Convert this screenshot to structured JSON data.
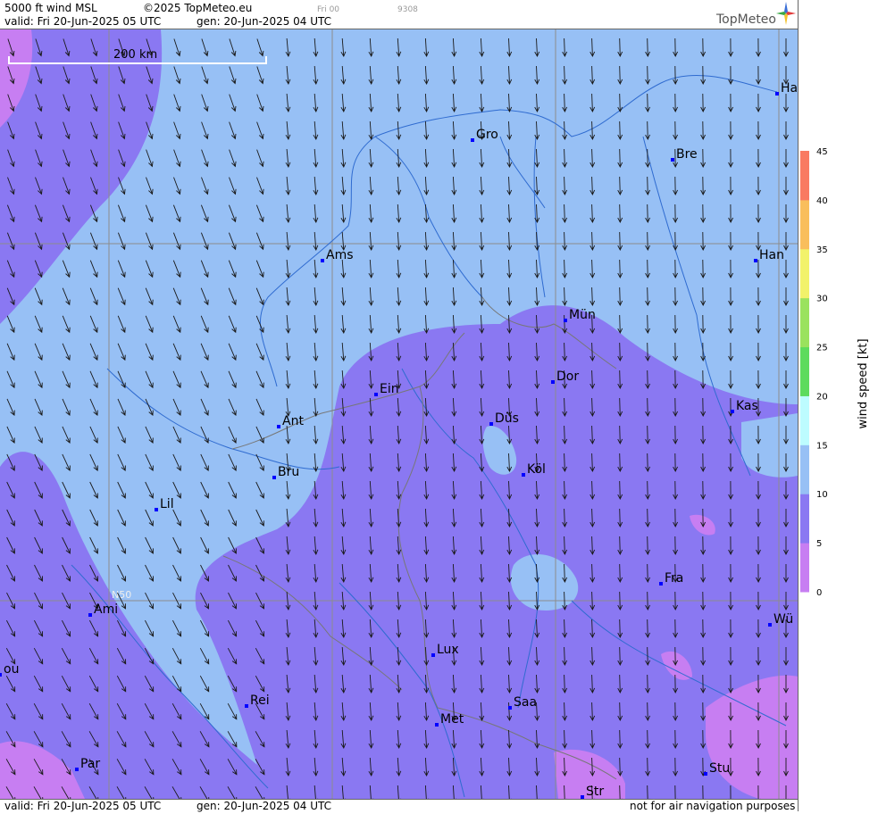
{
  "header": {
    "product": "5000 ft wind MSL",
    "copyright": "©2025 TopMeteo.eu",
    "valid": "valid:  Fri  20-Jun-2025  05 UTC",
    "gen": "gen: 20-Jun-2025 04 UTC",
    "faint_day": "Fri 00",
    "faint_code": "9308",
    "brand": "TopMeteo"
  },
  "footer": {
    "valid": "valid:  Fri  20-Jun-2025  05 UTC",
    "gen": "gen: 20-Jun-2025 04 UTC",
    "disclaimer": "not for air navigation purposes"
  },
  "map": {
    "scale_label": "200 km",
    "grid_label": "N50",
    "cities": [
      {
        "name": "Gro"
      },
      {
        "name": "Bre"
      },
      {
        "name": "Ha"
      },
      {
        "name": "Han"
      },
      {
        "name": "Ams"
      },
      {
        "name": "Mün"
      },
      {
        "name": "Dor"
      },
      {
        "name": "Ein"
      },
      {
        "name": "Düs"
      },
      {
        "name": "Kas"
      },
      {
        "name": "Ant"
      },
      {
        "name": "Bru"
      },
      {
        "name": "Köl"
      },
      {
        "name": "Lil"
      },
      {
        "name": "Fra"
      },
      {
        "name": "Ami"
      },
      {
        "name": "Wü"
      },
      {
        "name": "Lux"
      },
      {
        "name": "ou"
      },
      {
        "name": "Rei"
      },
      {
        "name": "Saa"
      },
      {
        "name": "Met"
      },
      {
        "name": "Par"
      },
      {
        "name": "Stu"
      },
      {
        "name": "Str"
      }
    ]
  },
  "legend": {
    "title": "wind speed [kt]",
    "ticks": [
      "45",
      "40",
      "35",
      "30",
      "25",
      "20",
      "15",
      "10",
      "5",
      "0"
    ],
    "colors": {
      "0-5": "#c77ef2",
      "5-10": "#8a78f2",
      "10-15": "#97c0f5",
      "15-20": "#bdfcff",
      "20-25": "#5ddb5d",
      "25-30": "#9ae25e",
      "30-35": "#f2f26a",
      "35-40": "#f9be5c",
      "40-45": "#f97a62"
    }
  }
}
